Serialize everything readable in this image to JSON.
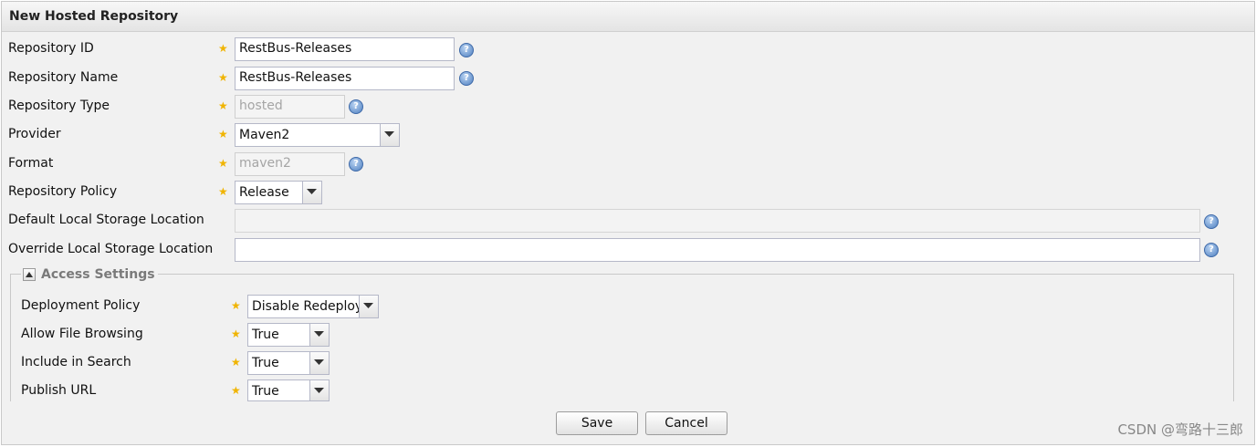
{
  "panel": {
    "title": "New Hosted Repository"
  },
  "fields": {
    "repository_id": {
      "label": "Repository ID",
      "value": "RestBus-Releases"
    },
    "repository_name": {
      "label": "Repository Name",
      "value": "RestBus-Releases"
    },
    "repository_type": {
      "label": "Repository Type",
      "value": "hosted"
    },
    "provider": {
      "label": "Provider",
      "value": "Maven2"
    },
    "format": {
      "label": "Format",
      "value": "maven2"
    },
    "repository_policy": {
      "label": "Repository Policy",
      "value": "Release"
    },
    "default_storage": {
      "label": "Default Local Storage Location",
      "value": ""
    },
    "override_storage": {
      "label": "Override Local Storage Location",
      "value": ""
    }
  },
  "access_settings": {
    "title": "Access Settings",
    "deployment_policy": {
      "label": "Deployment Policy",
      "value": "Disable Redeploy"
    },
    "allow_file_browsing": {
      "label": "Allow File Browsing",
      "value": "True"
    },
    "include_in_search": {
      "label": "Include in Search",
      "value": "True"
    },
    "publish_url": {
      "label": "Publish URL",
      "value": "True"
    }
  },
  "buttons": {
    "save": "Save",
    "cancel": "Cancel"
  },
  "required_marker": "★",
  "help_glyph": "?",
  "watermark": "CSDN @弯路十三郎",
  "icons": {
    "help": "help-icon",
    "dropdown": "chevron-down-icon",
    "collapse": "collapse-up-icon"
  },
  "colors": {
    "required_star": "#f0b400",
    "help_icon": "#4e7fc0",
    "panel_bg": "#f1f1f1"
  }
}
